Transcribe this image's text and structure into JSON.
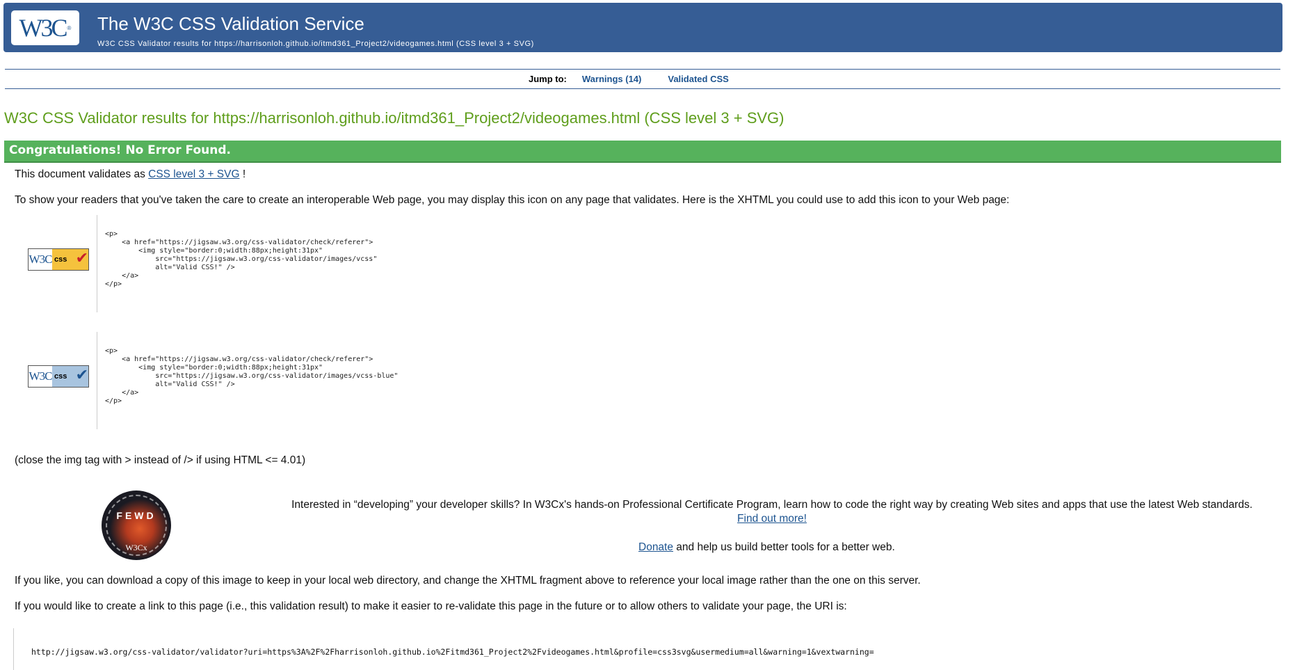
{
  "banner": {
    "logo_text": "W3C",
    "logo_reg": "®",
    "title": "The W3C CSS Validation Service",
    "subtitle": "W3C CSS Validator results for https://harrisonloh.github.io/itmd361_Project2/videogames.html (CSS level 3 + SVG)"
  },
  "jump": {
    "label": "Jump to:",
    "warnings": "Warnings (14)",
    "validated": "Validated CSS"
  },
  "results_title": "W3C CSS Validator results for https://harrisonloh.github.io/itmd361_Project2/videogames.html (CSS level 3 + SVG)",
  "congrats": "Congratulations! No Error Found.",
  "validates": {
    "prefix": "This document validates as ",
    "link": "CSS level 3 + SVG",
    "suffix": " !"
  },
  "show_readers": "To show your readers that you've taken the care to create an interoperable Web page, you may display this icon on any page that validates. Here is the XHTML you could use to add this icon to your Web page:",
  "snippets": [
    {
      "badge_w3c": "W3C",
      "badge_css": "css",
      "color": "#f5c23d",
      "check_color": "#c8202a",
      "code": "<p>\n    <a href=\"https://jigsaw.w3.org/css-validator/check/referer\">\n        <img style=\"border:0;width:88px;height:31px\"\n            src=\"https://jigsaw.w3.org/css-validator/images/vcss\"\n            alt=\"Valid CSS!\" />\n    </a>\n</p>"
    },
    {
      "badge_w3c": "W3C",
      "badge_css": "css",
      "color": "#a8c4df",
      "check_color": "#1d5490",
      "code": "<p>\n    <a href=\"https://jigsaw.w3.org/css-validator/check/referer\">\n        <img style=\"border:0;width:88px;height:31px\"\n            src=\"https://jigsaw.w3.org/css-validator/images/vcss-blue\"\n            alt=\"Valid CSS!\" />\n    </a>\n</p>"
    }
  ],
  "close_tag_note": "(close the img tag with > instead of /> if using HTML <= 4.01)",
  "promo": {
    "text": "Interested in “developing” your developer skills? In W3Cx's hands-on Professional Certificate Program, learn how to code the right way by creating Web sites and apps that use the latest Web standards.",
    "link": "Find out more!",
    "badge_letters": "FEWD",
    "badge_caption": "W3Cx"
  },
  "donate": {
    "link": "Donate",
    "suffix": " and help us build better tools for a better web."
  },
  "download_note": "If you like, you can download a copy of this image to keep in your local web directory, and change the XHTML fragment above to reference your local image rather than the one on this server.",
  "link_note": "If you would like to create a link to this page (i.e., this validation result) to make it easier to re-validate this page in the future or to allow others to validate your page, the URI is:",
  "uri": "http://jigsaw.w3.org/css-validator/validator?uri=https%3A%2F%2Fharrisonloh.github.io%2Fitmd361_Project2%2Fvideogames.html&profile=css3svg&usermedium=all&warning=1&vextwarning="
}
